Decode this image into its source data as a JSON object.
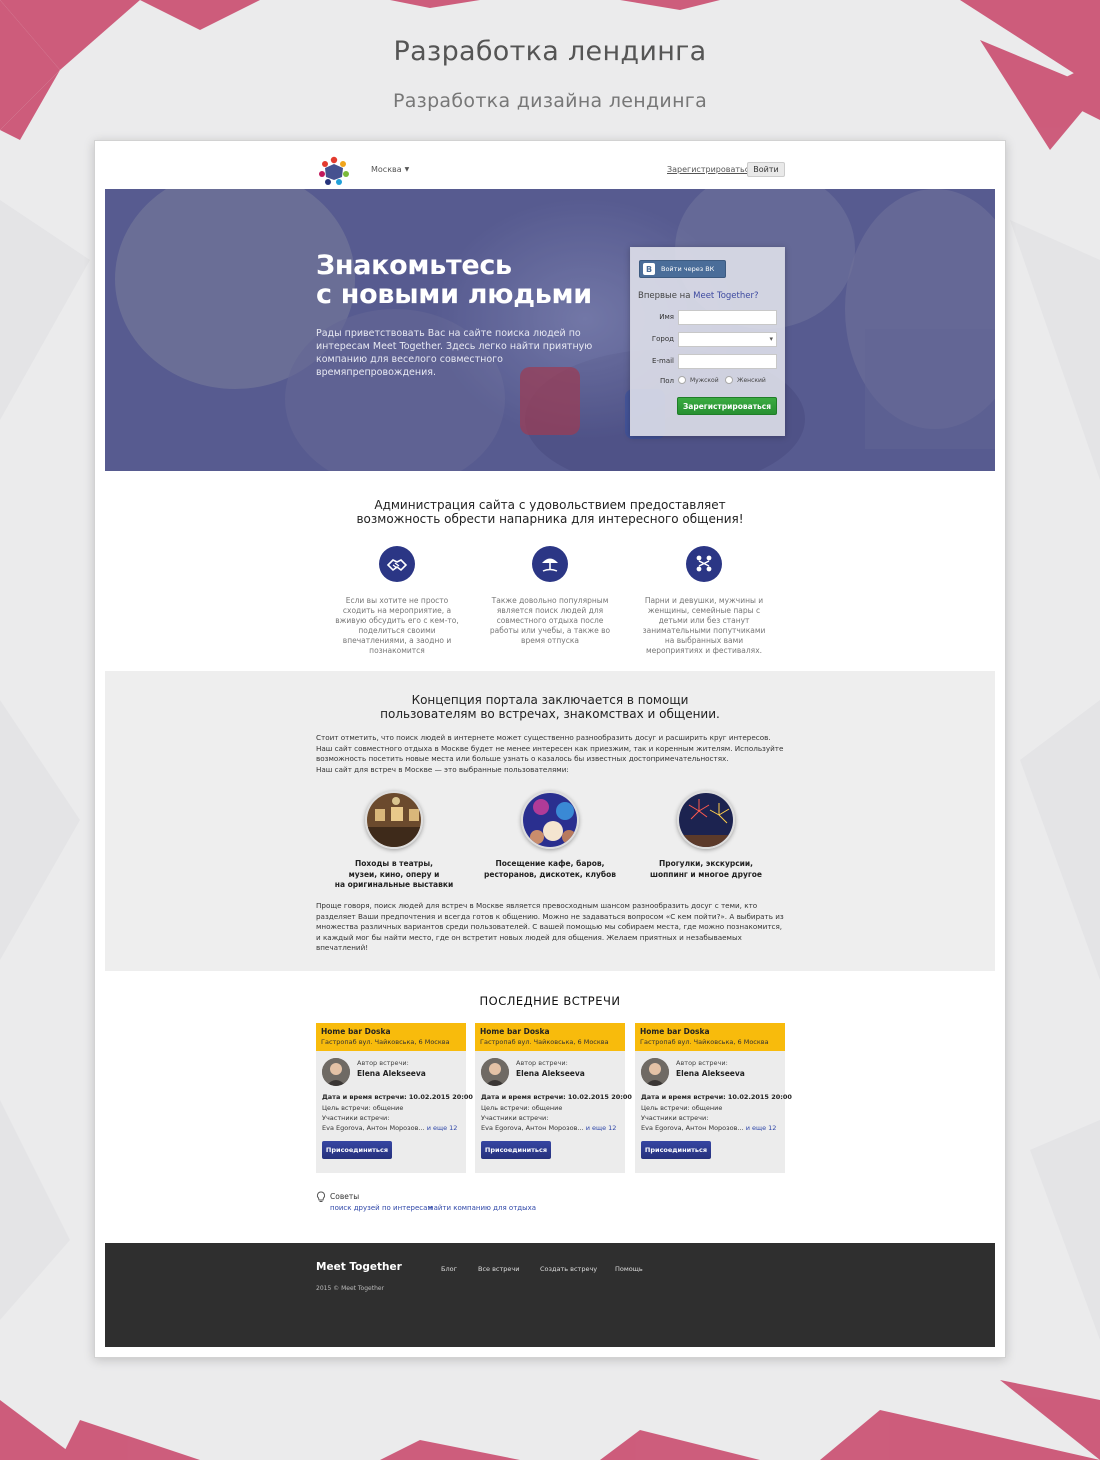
{
  "showcase": {
    "title": "Разработка лендинга",
    "subtitle": "Разработка дизайна лендинга"
  },
  "colors": {
    "background": "#ebebec",
    "decor_polygons": "#b7355c",
    "hero_overlay": "#5d6195",
    "accent_blue": "#2b3685",
    "register_green": "#2e9e3a",
    "meeting_yellow": "#f8bb0c",
    "footer": "#2f2f2f"
  },
  "header": {
    "logo_icon": "people-circle-logo",
    "city": "Москва",
    "register_link": "Зарегистрироваться",
    "login_button": "Войти"
  },
  "hero": {
    "title_line1": "Знакомьтесь",
    "title_line2": "с новыми людьми",
    "text": "Рады приветствовать Вас на сайте поиска людей по интересам Meet Together. Здесь легко найти приятную компанию для веселого совместного времяпрепровождения."
  },
  "register_form": {
    "vk_button": "Войти через ВК",
    "vk_badge": "B",
    "first_time": "Впервые на",
    "brand": "Meet Together?",
    "name_label": "Имя",
    "name_value": "",
    "city_label": "Город",
    "city_value": "",
    "email_label": "E-mail",
    "email_value": "",
    "gender_label": "Пол",
    "gender_male": "Мужской",
    "gender_female": "Женский",
    "submit": "Зарегистрироваться"
  },
  "intro": {
    "heading_line1": "Администрация сайта с удовольствием предоставляет",
    "heading_line2": "возможность обрести напарника для интересного общения!",
    "features": [
      {
        "icon": "handshake-icon",
        "text": "Если вы хотите не просто сходить на мероприятие, а вживую обсудить его с кем-то, поделиться своими впечатлениями, а заодно и познакомится"
      },
      {
        "icon": "beach-umbrella-icon",
        "text": "Также довольно популярным является поиск людей для совместного отдыха после работы или учебы, а также во время отпуска"
      },
      {
        "icon": "people-network-icon",
        "text": "Парни и девушки, мужчины и женщины, семейные пары с детьми или без станут занимательными попутчиками на выбранных вами мероприятиях и фестивалях."
      }
    ]
  },
  "concept": {
    "heading_line1": "Концепция портала заключается в помощи",
    "heading_line2": "пользователям во встречах, знакомствах и общении.",
    "paragraph1": "Стоит отметить, что поиск людей в интернете может существенно разнообразить досуг и расширить круг интересов.",
    "paragraph2": "Наш сайт совместного отдыха в Москве будет не менее интересен как приезжим, так и коренным жителям. Используйте возможность посетить новые места или больше узнать о казалось бы известных достопримечательностях.",
    "paragraph3": "Наш сайт для встреч в Москве — это выбранные пользователями:",
    "places": [
      {
        "icon": "gallery-photo",
        "line1": "Походы в театры,",
        "line2": "музеи, кино, оперу и",
        "line3": "на оригинальные выставки"
      },
      {
        "icon": "party-photo",
        "line1": "Посещение кафе, баров,",
        "line2": "ресторанов, дискотек, клубов",
        "line3": ""
      },
      {
        "icon": "fireworks-photo",
        "line1": "Прогулки, экскурсии,",
        "line2": "шоппинг и многое другое",
        "line3": ""
      }
    ],
    "closing": "Проще говоря, поиск людей для встреч в Москве является превосходным шансом разнообразить досуг с теми, кто разделяет Ваши предпочтения и всегда готов к общению. Можно не задаваться вопросом «С кем пойти?». А выбирать из множества различных вариантов среди пользователей. С вашей помощью мы собираем места, где можно познакомится, и каждый мог бы найти место, где он встретит новых людей для общения. Желаем приятных и незабываемых впечатлений!"
  },
  "meetings": {
    "title": "ПОСЛЕДНИЕ ВСТРЕЧИ",
    "cards": [
      {
        "place": "Home bar Doska",
        "address": "Гастропаб вул. Чайковська, 6 Москва",
        "author_label": "Автор встречи:",
        "author": "Elena Alekseeva",
        "datetime_label": "Дата и время встречи:",
        "datetime": "10.02.2015 20:00",
        "goal": "Цель встречи: общение",
        "participants_label": "Участники встречи:",
        "participants": "Eva Egorova, Антон Морозов...",
        "more": "и еще 12",
        "join": "Присоединиться"
      },
      {
        "place": "Home bar Doska",
        "address": "Гастропаб вул. Чайковська, 6 Москва",
        "author_label": "Автор встречи:",
        "author": "Elena Alekseeva",
        "datetime_label": "Дата и время встречи:",
        "datetime": "10.02.2015 20:00",
        "goal": "Цель встречи: общение",
        "participants_label": "Участники встречи:",
        "participants": "Eva Egorova, Антон Морозов...",
        "more": "и еще 12",
        "join": "Присоединиться"
      },
      {
        "place": "Home bar Doska",
        "address": "Гастропаб вул. Чайковська, 6 Москва",
        "author_label": "Автор встречи:",
        "author": "Elena Alekseeva",
        "datetime_label": "Дата и время встречи:",
        "datetime": "10.02.2015 20:00",
        "goal": "Цель встречи: общение",
        "participants_label": "Участники встречи:",
        "participants": "Eva Egorova, Антон Морозов...",
        "more": "и еще 12",
        "join": "Присоединиться"
      }
    ],
    "tips_title": "Советы",
    "tips_links": [
      "поиск друзей по интересам",
      "найти компанию для отдыха"
    ]
  },
  "footer": {
    "brand": "Meet Together",
    "copyright": "2015 © Meet Together",
    "nav": [
      "Блог",
      "Все встречи",
      "Создать встречу",
      "Помощь"
    ]
  }
}
